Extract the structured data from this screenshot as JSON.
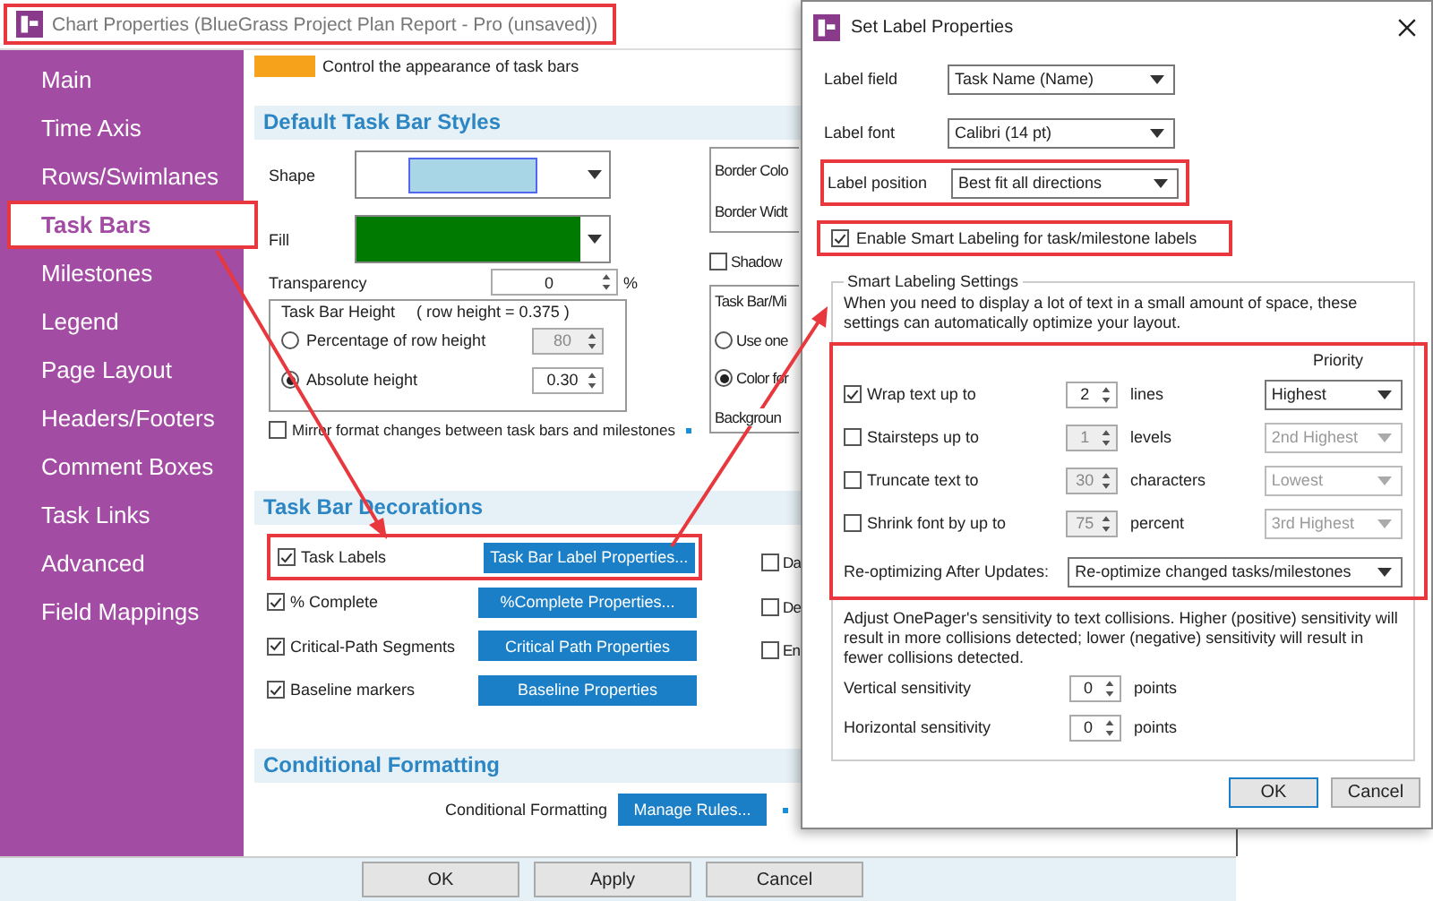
{
  "main_window": {
    "title": "Chart Properties (BlueGrass Project Plan Report - Pro (unsaved))",
    "sidebar": {
      "items": [
        {
          "label": "Main",
          "selected": false
        },
        {
          "label": "Time Axis",
          "selected": false
        },
        {
          "label": "Rows/Swimlanes",
          "selected": false
        },
        {
          "label": "Task Bars",
          "selected": true
        },
        {
          "label": "Milestones",
          "selected": false
        },
        {
          "label": "Legend",
          "selected": false
        },
        {
          "label": "Page Layout",
          "selected": false
        },
        {
          "label": "Headers/Footers",
          "selected": false
        },
        {
          "label": "Comment Boxes",
          "selected": false
        },
        {
          "label": "Task Links",
          "selected": false
        },
        {
          "label": "Advanced",
          "selected": false
        },
        {
          "label": "Field Mappings",
          "selected": false
        }
      ]
    },
    "intro": "Control the appearance of task bars",
    "default_styles": {
      "heading": "Default Task Bar Styles",
      "shape_label": "Shape",
      "fill_label": "Fill",
      "transparency": {
        "label": "Transparency",
        "value": "0",
        "unit": "%"
      },
      "height_group": {
        "title": "Task Bar Height",
        "note": "( row height =   0.375  )",
        "options": [
          {
            "label": "Percentage of row height",
            "selected": false,
            "value": "80"
          },
          {
            "label": "Absolute height",
            "selected": true,
            "value": "0.30"
          }
        ]
      },
      "mirror": {
        "label": "Mirror format changes between task bars and milestones",
        "checked": false
      },
      "border_labels": [
        "Border Colo",
        "Border Widt"
      ],
      "shadow": {
        "label": "Shadow",
        "checked": false
      },
      "color_group": {
        "title": "Task Bar/Mi",
        "options": [
          {
            "label": "Use one",
            "selected": false
          },
          {
            "label": "Color for",
            "selected": true
          }
        ],
        "footer": "Backgroun"
      }
    },
    "decorations": {
      "heading": "Task Bar Decorations",
      "rows": [
        {
          "label": "Task Labels",
          "checked": true,
          "button": "Task Bar Label Properties..."
        },
        {
          "label": "% Complete",
          "checked": true,
          "button": "%Complete Properties..."
        },
        {
          "label": "Critical-Path Segments",
          "checked": true,
          "button": "Critical Path Properties"
        },
        {
          "label": "Baseline markers",
          "checked": true,
          "button": "Baseline Properties"
        }
      ],
      "side_checks": [
        {
          "label": "Da",
          "checked": false
        },
        {
          "label": "De",
          "checked": false
        },
        {
          "label": "En",
          "checked": false
        }
      ]
    },
    "conditional": {
      "heading": "Conditional Formatting",
      "label": "Conditional Formatting",
      "button": "Manage Rules..."
    },
    "buttons": [
      "OK",
      "Apply",
      "Cancel"
    ]
  },
  "dialog": {
    "title": "Set Label Properties",
    "fields": [
      {
        "label": "Label field",
        "value": "Task Name (Name)"
      },
      {
        "label": "Label font",
        "value": "Calibri (14 pt)"
      },
      {
        "label": "Label position",
        "value": "Best fit all directions"
      }
    ],
    "smart_labeling": {
      "label": "Enable Smart Labeling for task/milestone labels",
      "checked": true
    },
    "settings": {
      "title": "Smart Labeling Settings",
      "description": "When you need to display a lot of text in a small amount of space, these settings can automatically optimize your layout.",
      "priority_heading": "Priority",
      "rules": [
        {
          "label": "Wrap text up to",
          "checked": true,
          "value": "2",
          "unit": "lines",
          "priority": "Highest"
        },
        {
          "label": "Stairsteps up to",
          "checked": false,
          "value": "1",
          "unit": "levels",
          "priority": "2nd Highest"
        },
        {
          "label": "Truncate text to",
          "checked": false,
          "value": "30",
          "unit": "characters",
          "priority": "Lowest"
        },
        {
          "label": "Shrink font by up to",
          "checked": false,
          "value": "75",
          "unit": "percent",
          "priority": "3rd Highest"
        }
      ],
      "reoptimize": {
        "label": "Re-optimizing After Updates:",
        "value": "Re-optimize changed tasks/milestones"
      },
      "sensitivity_note": "Adjust OnePager's sensitivity to text collisions. Higher (positive) sensitivity will result in more collisions detected; lower (negative) sensitivity will result in fewer collisions detected.",
      "sensitivity": [
        {
          "label": "Vertical sensitivity",
          "value": "0",
          "unit": "points"
        },
        {
          "label": "Horizontal sensitivity",
          "value": "0",
          "unit": "points"
        }
      ]
    },
    "buttons": [
      {
        "label": "OK",
        "default": true
      },
      {
        "label": "Cancel",
        "default": false
      }
    ]
  }
}
